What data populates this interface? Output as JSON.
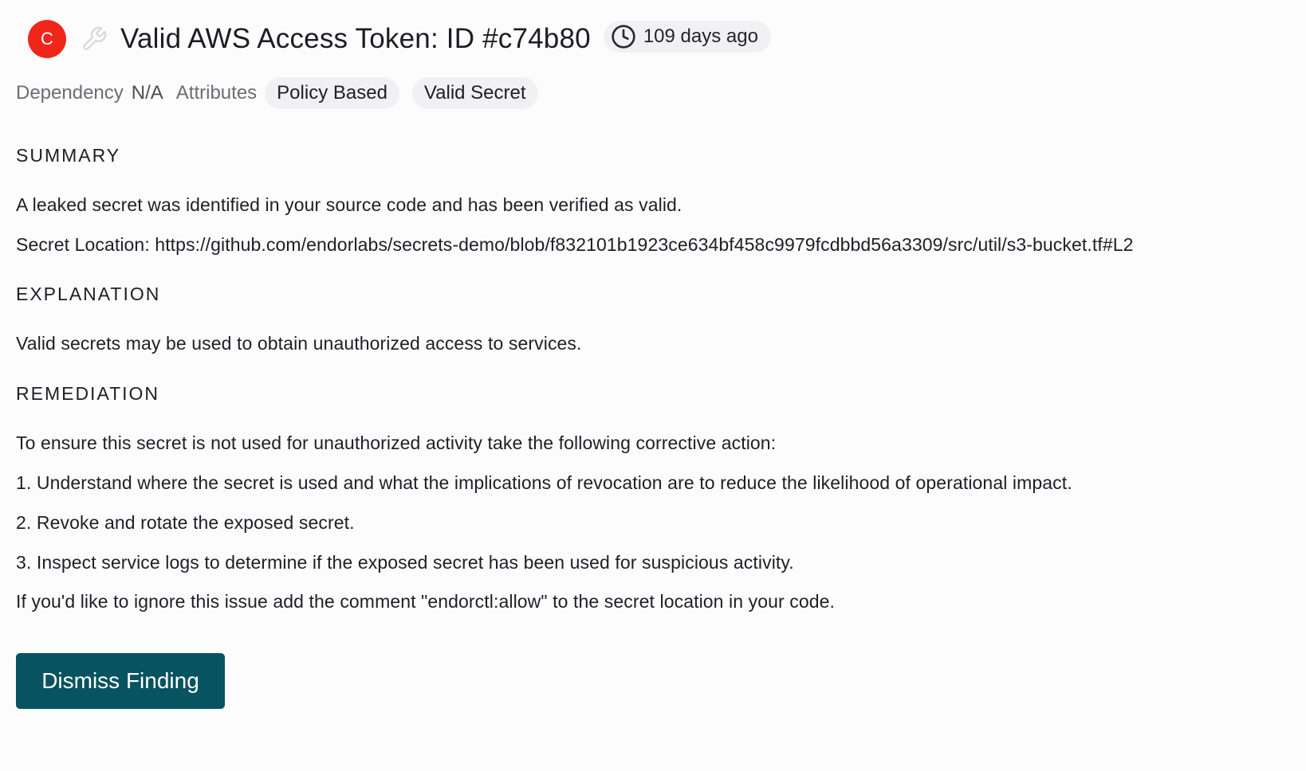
{
  "header": {
    "severity_letter": "C",
    "severity_color": "#f0261b",
    "fix_icon": "wrench-icon",
    "title": "Valid AWS Access Token: ID #c74b80",
    "age_icon": "clock-icon",
    "age": "109 days ago"
  },
  "attributes": {
    "dependency_label": "Dependency",
    "dependency_value": "N/A",
    "attributes_label": "Attributes",
    "tags": [
      "Policy Based",
      "Valid Secret"
    ]
  },
  "summary": {
    "heading": "SUMMARY",
    "text": "A leaked secret was identified in your source code and has been verified as valid.",
    "location": "Secret Location: https://github.com/endorlabs/secrets-demo/blob/f832101b1923ce634bf458c9979fcdbbd56a3309/src/util/s3-bucket.tf#L2"
  },
  "explanation": {
    "heading": "EXPLANATION",
    "text": "Valid secrets may be used to obtain unauthorized access to services."
  },
  "remediation": {
    "heading": "REMEDIATION",
    "intro": "To ensure this secret is not used for unauthorized activity take the following corrective action:",
    "steps": [
      "1. Understand where the secret is used and what the implications of revocation are to reduce the likelihood of operational impact.",
      "2. Revoke and rotate the exposed secret.",
      "3. Inspect service logs to determine if the exposed secret has been used for suspicious activity."
    ],
    "ignore_note": "If you'd like to ignore this issue add the comment \"endorctl:allow\" to the secret location in your code."
  },
  "actions": {
    "dismiss_label": "Dismiss Finding",
    "dismiss_color": "#075360"
  }
}
